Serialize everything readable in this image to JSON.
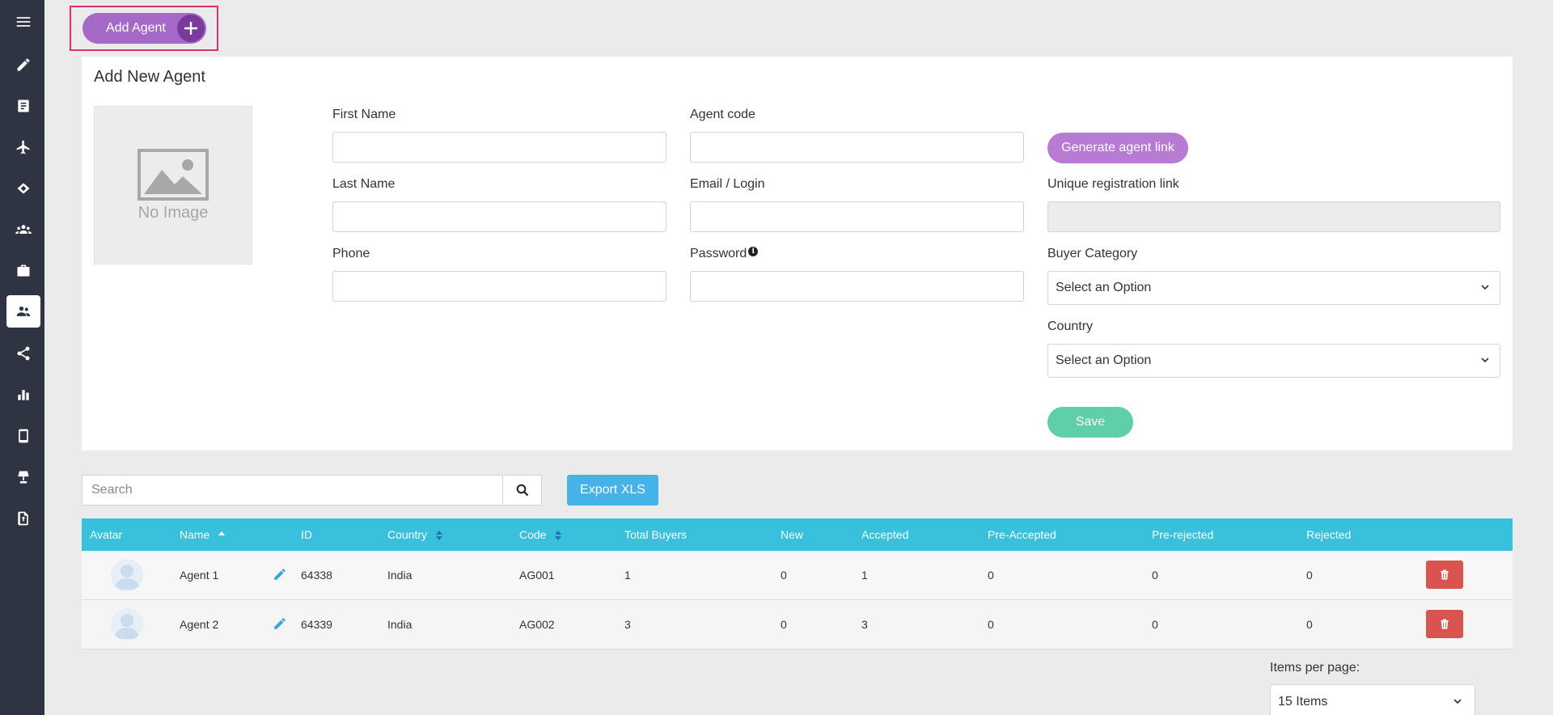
{
  "sidebar": {
    "items": [
      {
        "icon": "menu-icon"
      },
      {
        "icon": "pencil-icon"
      },
      {
        "icon": "list-icon"
      },
      {
        "icon": "plane-icon"
      },
      {
        "icon": "handshake-icon"
      },
      {
        "icon": "users-icon"
      },
      {
        "icon": "briefcase-icon"
      },
      {
        "icon": "agents-icon",
        "active": true
      },
      {
        "icon": "share-icon"
      },
      {
        "icon": "bar-chart-icon"
      },
      {
        "icon": "mobile-icon"
      },
      {
        "icon": "lamp-icon"
      },
      {
        "icon": "file-upload-icon"
      }
    ]
  },
  "toolbar": {
    "add_agent_label": "Add Agent"
  },
  "form": {
    "title": "Add New Agent",
    "no_image_text": "No Image",
    "first_name_label": "First Name",
    "last_name_label": "Last Name",
    "phone_label": "Phone",
    "agent_code_label": "Agent code",
    "email_label": "Email / Login",
    "password_label": "Password",
    "generate_link_label": "Generate agent link",
    "unique_link_label": "Unique registration link",
    "buyer_category_label": "Buyer Category",
    "buyer_category_value": "Select an Option",
    "country_label": "Country",
    "country_value": "Select an Option",
    "save_label": "Save",
    "first_name_value": "",
    "last_name_value": "",
    "phone_value": "",
    "agent_code_value": "",
    "email_value": "",
    "password_value": "",
    "unique_link_value": ""
  },
  "search": {
    "placeholder": "Search",
    "export_label": "Export XLS"
  },
  "table": {
    "columns": [
      "Avatar",
      "Name",
      "ID",
      "Country",
      "Code",
      "Total Buyers",
      "New",
      "Accepted",
      "Pre-Accepted",
      "Pre-rejected",
      "Rejected"
    ],
    "rows": [
      {
        "name": "Agent 1",
        "id": "64338",
        "country": "India",
        "code": "AG001",
        "total_buyers": "1",
        "new": "0",
        "accepted": "1",
        "pre_accepted": "0",
        "pre_rejected": "0",
        "rejected": "0"
      },
      {
        "name": "Agent 2",
        "id": "64339",
        "country": "India",
        "code": "AG002",
        "total_buyers": "3",
        "new": "0",
        "accepted": "3",
        "pre_accepted": "0",
        "pre_rejected": "0",
        "rejected": "0"
      }
    ]
  },
  "pagination": {
    "items_per_page_label": "Items per page:",
    "items_per_page_value": "15 Items"
  },
  "colors": {
    "sidebar_bg": "#2f3442",
    "accent_purple": "#a569c8",
    "table_header": "#38c0dc",
    "save_green": "#5fcfa9",
    "export_blue": "#45b3e8",
    "delete_red": "#d9534f"
  }
}
